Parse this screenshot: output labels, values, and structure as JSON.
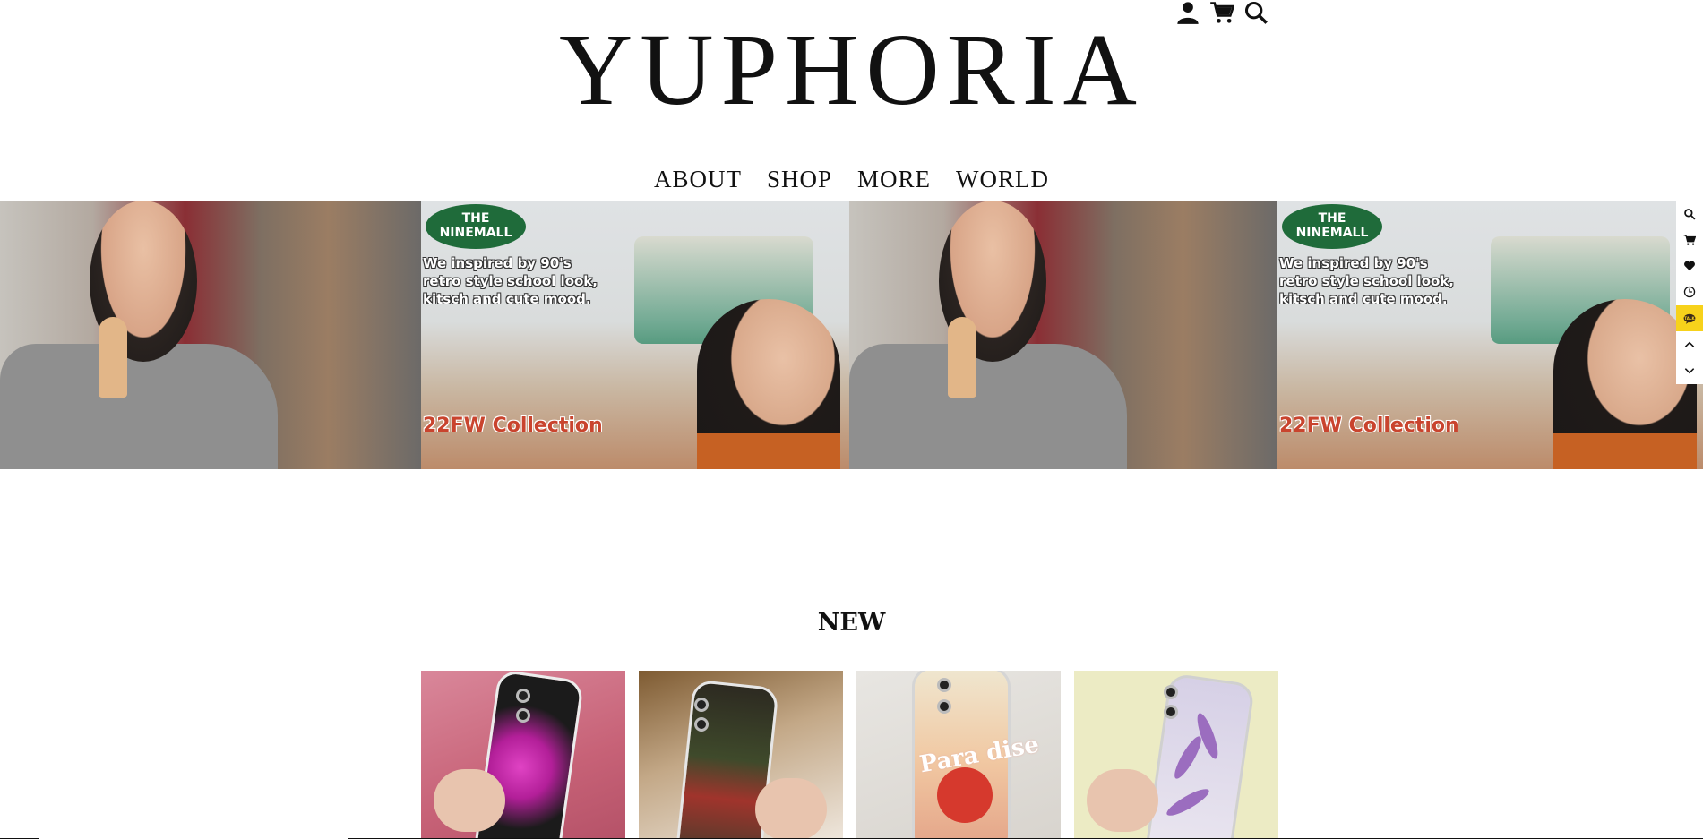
{
  "brand": {
    "logo_text": "YUPHORIA"
  },
  "header_icons": [
    "user-icon",
    "cart-icon",
    "search-icon"
  ],
  "nav": {
    "items": [
      "ABOUT",
      "SHOP",
      "MORE",
      "WORLD"
    ]
  },
  "banner": {
    "badge_text": "THE NINEMALL",
    "tagline": "We inspired by 90's retro style school look, kitsch and cute mood.",
    "collection": "22FW Collection"
  },
  "sidebar": {
    "icons": [
      "search-icon",
      "cart-icon",
      "heart-icon",
      "clock-icon",
      "kakao-talk-icon",
      "arrow-up-icon",
      "arrow-down-icon"
    ],
    "talk_label": "TALK"
  },
  "section": {
    "title": "NEW"
  },
  "products": [
    {
      "name": "product-1",
      "sticker_text": ""
    },
    {
      "name": "product-2",
      "sticker_text": ""
    },
    {
      "name": "product-3",
      "sticker_text": "Para dise"
    },
    {
      "name": "product-4",
      "sticker_text": ""
    }
  ],
  "colors": {
    "talk_yellow": "#f7d21b",
    "badge_green": "#1f6b3a",
    "collection_red": "#c9442e"
  }
}
